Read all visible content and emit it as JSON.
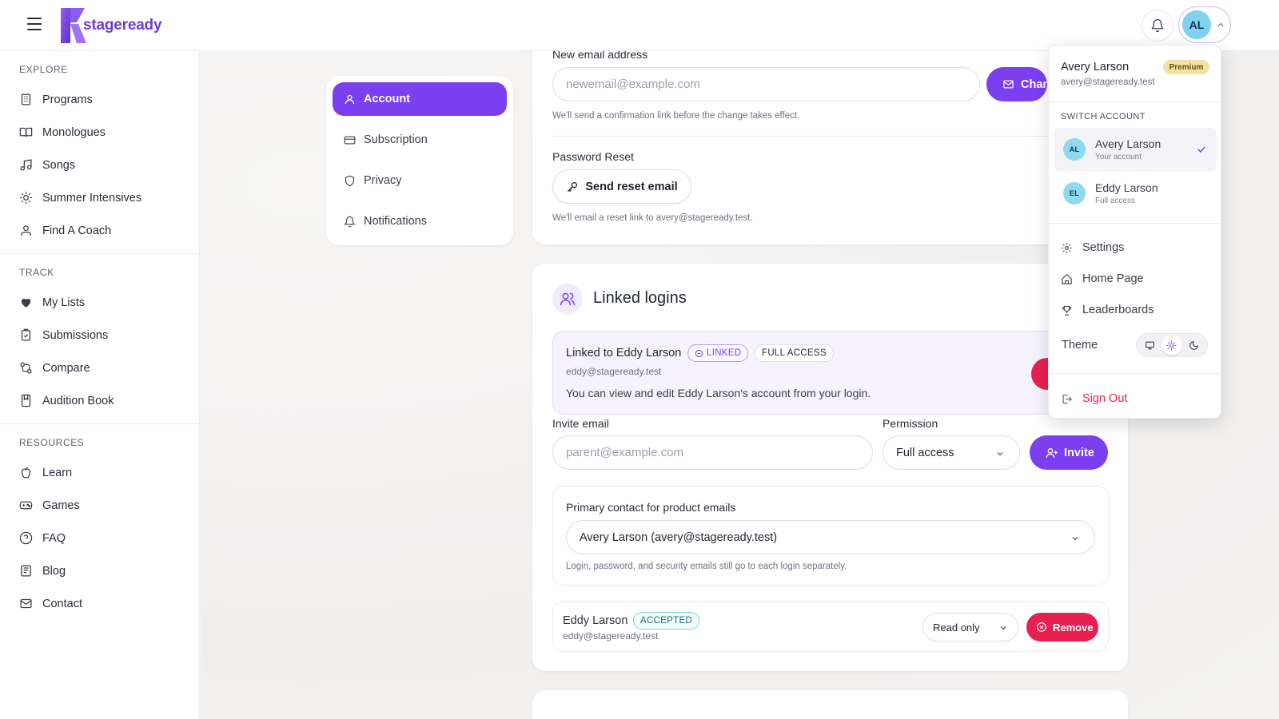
{
  "brand": {
    "name": "stageready",
    "accent": "#7b3ff0",
    "danger": "#e8204f"
  },
  "header": {
    "avatar_initials": "AL"
  },
  "sidebar": {
    "sections": [
      {
        "heading": "EXPLORE",
        "items": [
          {
            "label": "Programs",
            "icon": "building-icon"
          },
          {
            "label": "Monologues",
            "icon": "book-icon"
          },
          {
            "label": "Songs",
            "icon": "music-icon"
          },
          {
            "label": "Summer Intensives",
            "icon": "sun-icon"
          },
          {
            "label": "Find A Coach",
            "icon": "users-icon"
          }
        ]
      },
      {
        "heading": "TRACK",
        "items": [
          {
            "label": "My Lists",
            "icon": "heart-icon"
          },
          {
            "label": "Submissions",
            "icon": "clipboard-check-icon"
          },
          {
            "label": "Compare",
            "icon": "compare-icon"
          },
          {
            "label": "Audition Book",
            "icon": "bookmark-book-icon"
          }
        ]
      },
      {
        "heading": "RESOURCES",
        "items": [
          {
            "label": "Learn",
            "icon": "apple-icon"
          },
          {
            "label": "Games",
            "icon": "gamepad-icon"
          },
          {
            "label": "FAQ",
            "icon": "question-icon"
          },
          {
            "label": "Blog",
            "icon": "newspaper-icon"
          },
          {
            "label": "Contact",
            "icon": "mail-icon"
          }
        ]
      }
    ]
  },
  "settings_tabs": [
    {
      "label": "Account",
      "icon": "user-icon",
      "active": true
    },
    {
      "label": "Subscription",
      "icon": "credit-card-icon",
      "active": false
    },
    {
      "label": "Privacy",
      "icon": "shield-icon",
      "active": false
    },
    {
      "label": "Notifications",
      "icon": "bell-icon",
      "active": false
    }
  ],
  "email_change": {
    "label": "New email address",
    "placeholder": "newemail@example.com",
    "button_label": "Chan",
    "hint": "We'll send a confirmation link before the change takes effect."
  },
  "password_reset": {
    "label": "Password Reset",
    "button_label": "Send reset email",
    "hint": "We'll email a reset link to avery@stageready.test."
  },
  "linked_logins": {
    "title": "Linked logins",
    "linked": {
      "title": "Linked to Eddy Larson",
      "status_badge": "LINKED",
      "access_badge": "FULL ACCESS",
      "email": "eddy@stageready.test",
      "description": "You can view and edit Eddy Larson's account from your login."
    },
    "invite": {
      "email_label": "Invite email",
      "email_placeholder": "parent@example.com",
      "permission_label": "Permission",
      "permission_value": "Full access",
      "button_label": "Invite"
    },
    "primary_contact": {
      "label": "Primary contact for product emails",
      "value": "Avery Larson (avery@stageready.test)",
      "hint": "Login, password, and security emails still go to each login separately."
    },
    "members": [
      {
        "name": "Eddy Larson",
        "status": "ACCEPTED",
        "email": "eddy@stageready.test",
        "permission": "Read only",
        "remove_label": "Remove"
      }
    ]
  },
  "account_menu": {
    "name": "Avery Larson",
    "email": "avery@stageready.test",
    "plan_badge": "Premium",
    "switch_heading": "SWITCH ACCOUNT",
    "accounts": [
      {
        "initials": "AL",
        "name": "Avery Larson",
        "subtitle": "Your account",
        "active": true
      },
      {
        "initials": "EL",
        "name": "Eddy Larson",
        "subtitle": "Full access",
        "active": false
      }
    ],
    "items": [
      {
        "label": "Settings",
        "icon": "gear-icon"
      },
      {
        "label": "Home Page",
        "icon": "home-icon"
      },
      {
        "label": "Leaderboards",
        "icon": "trophy-icon"
      }
    ],
    "theme_label": "Theme",
    "theme_options": [
      "monitor-icon",
      "sun-icon",
      "moon-icon"
    ],
    "theme_selected": "sun-icon",
    "sign_out": "Sign Out"
  }
}
